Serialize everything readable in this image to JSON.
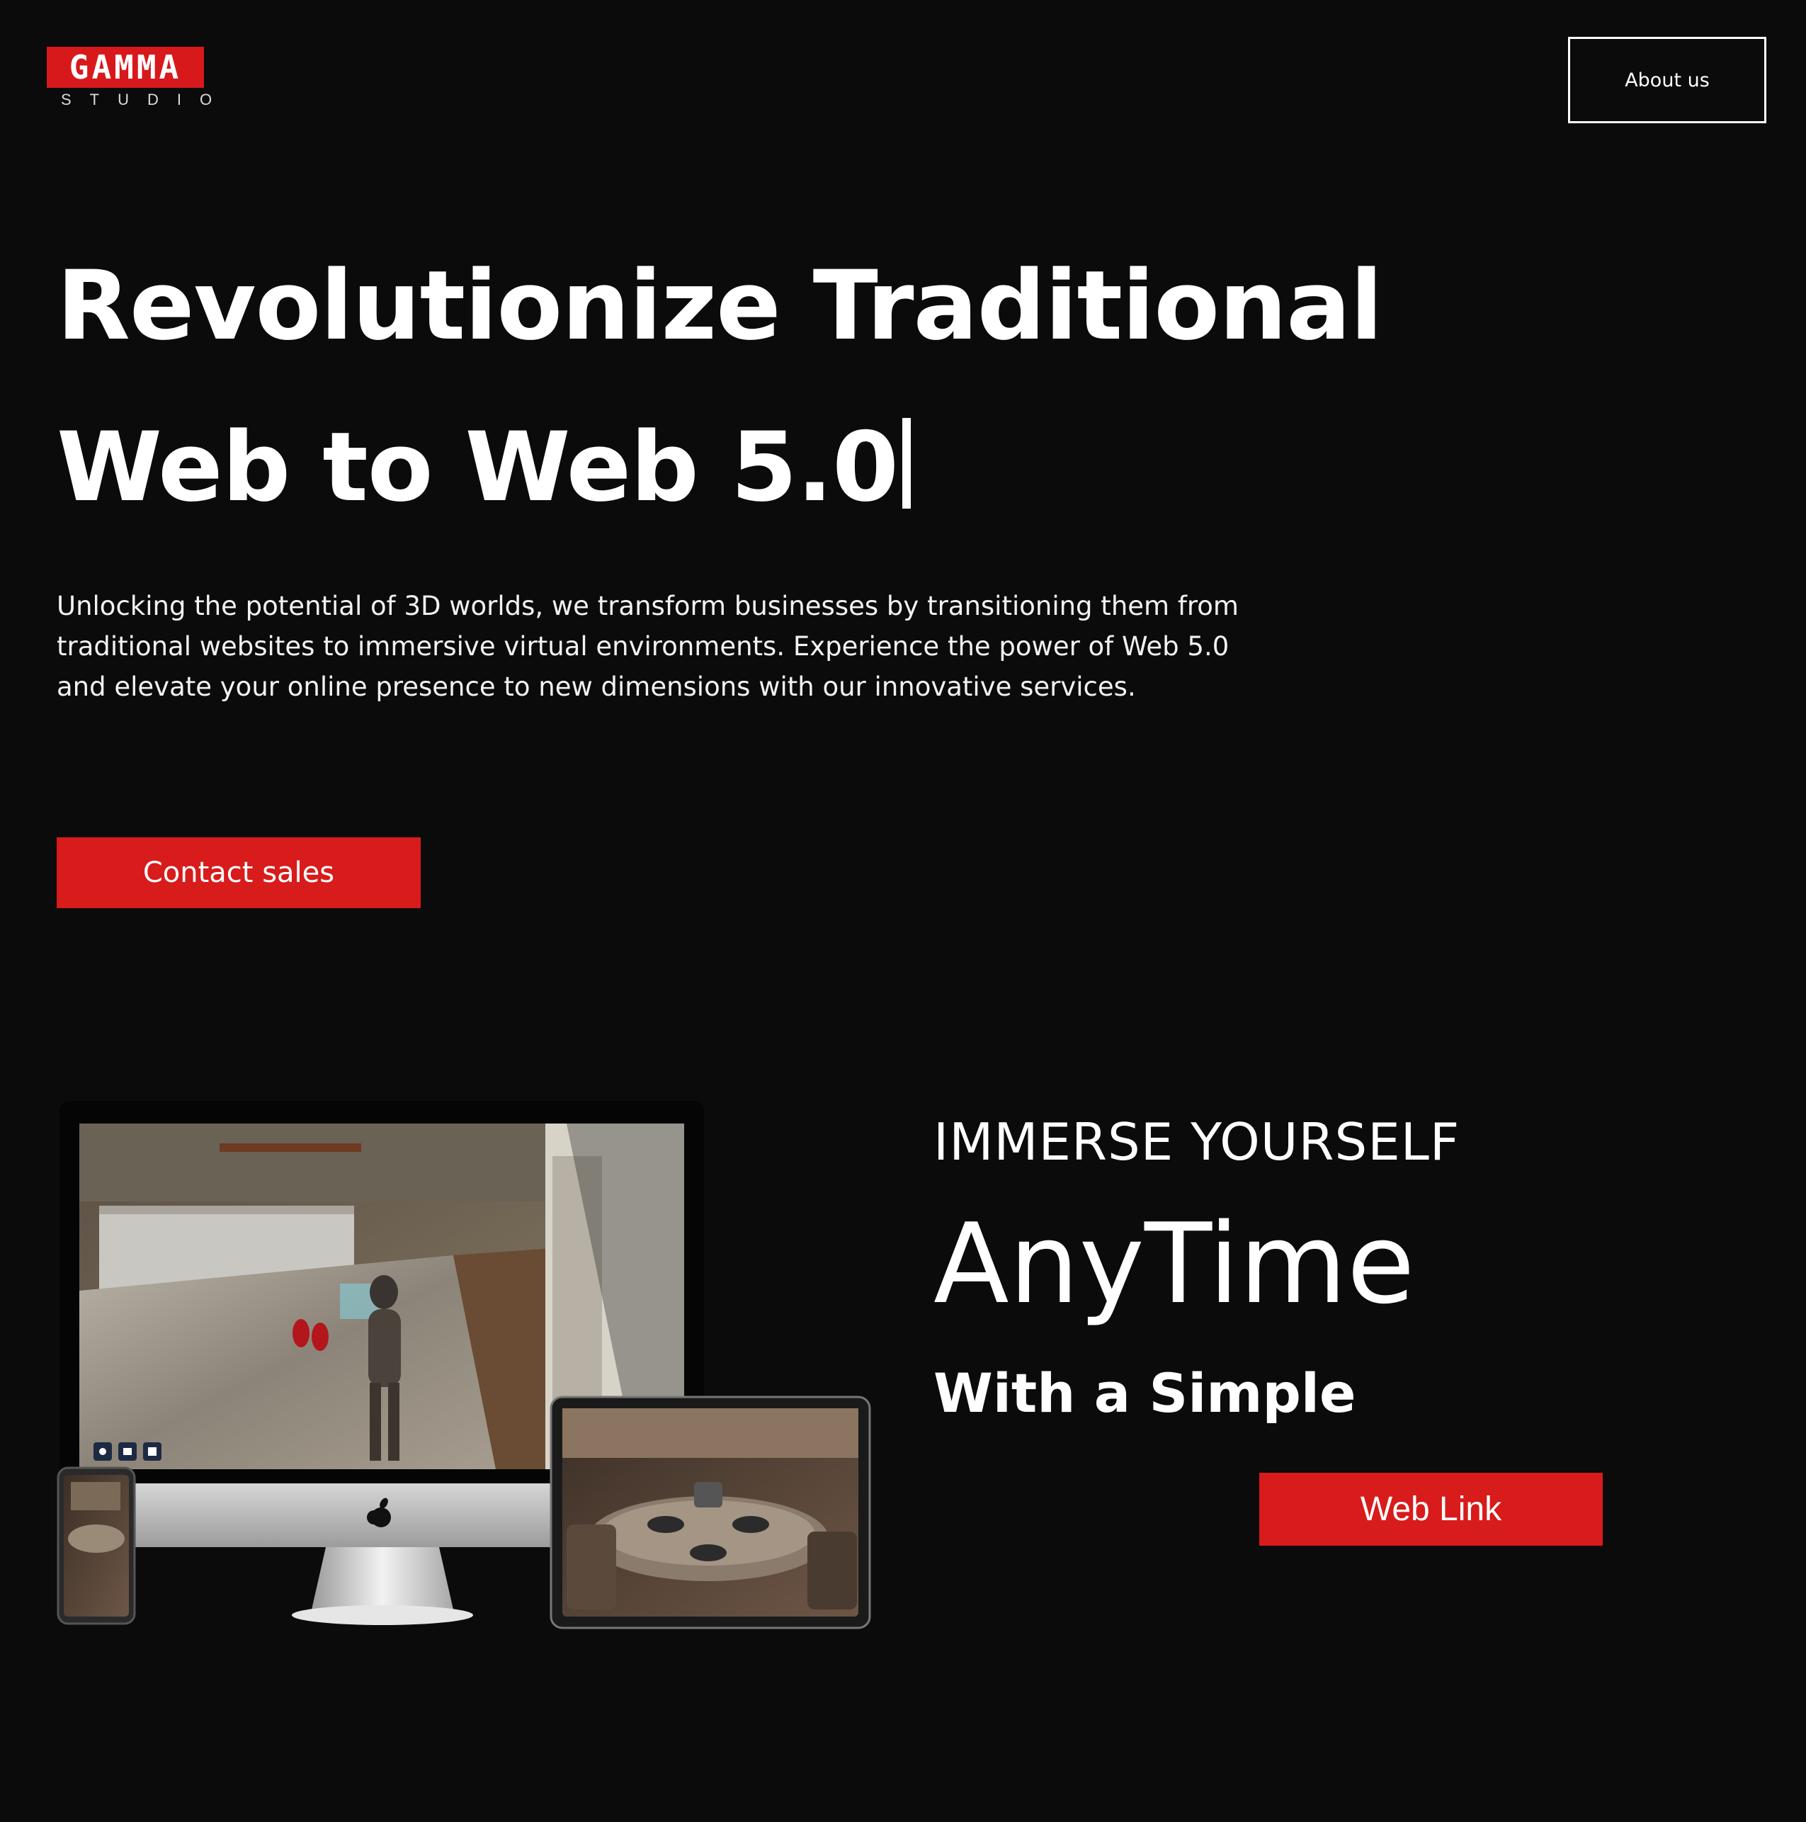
{
  "brand": {
    "logo_text": "GAMMA",
    "logo_sub": "STUDIO"
  },
  "nav": {
    "about_label": "About us"
  },
  "hero": {
    "headline_line1": "Revolutionize Traditional",
    "headline_line2": "Web to Web 5.0",
    "intro": "Unlocking the potential of 3D worlds, we transform businesses by transitioning them from traditional websites to immersive virtual environments. Experience the power of Web 5.0 and elevate your online presence to new dimensions with our innovative services.",
    "cta_label": "Contact sales"
  },
  "feature": {
    "kicker": "IMMERSE YOURSELF",
    "title": "AnyTime",
    "subtitle": "With a Simple",
    "cta_label": "Web Link"
  },
  "colors": {
    "accent": "#d81b1b",
    "background": "#0b0b0b",
    "text": "#ffffff"
  },
  "icons": [
    "camera-icon",
    "video-icon",
    "share-icon",
    "apple-logo-icon"
  ]
}
